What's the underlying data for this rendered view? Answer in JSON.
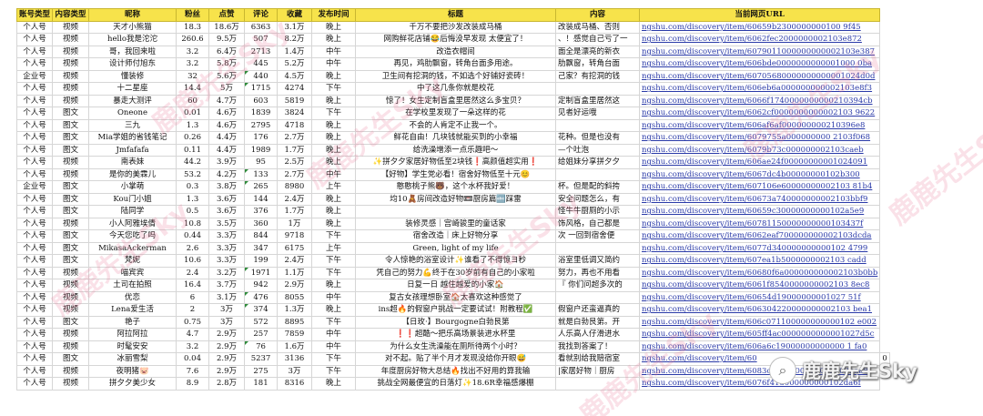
{
  "headers": [
    "账号类型",
    "内容类型",
    "昵称",
    "粉丝",
    "点赞",
    "评论",
    "收藏",
    "发布时间",
    "标题",
    "内容",
    "当前网页URL"
  ],
  "rows": [
    [
      "个人号",
      "视频",
      "天才小熊猫",
      "18.3",
      "18.6万",
      "6363",
      "3.1万",
      "晚上",
      "千万不要把沙发改装成马桶",
      "改装成马桶、否则",
      "ngshu.com/discovery/item/60659b2300000000100 9f45"
    ],
    [
      "个人号",
      "视频",
      "hello我是沱沱",
      "260.6",
      "9.5万",
      "507",
      "8.2万",
      "晚上",
      "网购鲜花店铺😂后悔没早发现 太便宜了！",
      "、！感觉自己亏了一",
      "ngshu.com/discovery/item/6062fec2000000002103e872"
    ],
    [
      "个人号",
      "视频",
      "哥，我回来啦",
      "3.2",
      "6.4万",
      "2713",
      "1.4万",
      "中午",
      "改造衣帽间",
      "面全是漂亮的新衣",
      "ngshu.com/discovery/item/6079011000000000002103e387"
    ],
    [
      "个人号",
      "视频",
      "设计师付旭东",
      "3.2",
      "5.8万",
      "445",
      "5.2万",
      "中午",
      "再见，鸡肋飘窗，转角台面多用途。",
      "肋飘窗，转角台面",
      "ngshu.com/discovery/item/606bde0000000000001000 0ba"
    ],
    [
      "企业号",
      "视频",
      "懂装修",
      "32",
      "5.6万",
      "440",
      "4.5万",
      "晚上",
      "卫生间有挖洞的钱，不如选个好铺好瓷砖！",
      "己家？有挖洞的钱",
      "ngshu.com/discovery/item/60705680000000000001024d0d"
    ],
    [
      "个人号",
      "视频",
      "十二星座",
      "14.4",
      "5万",
      "1715",
      "4274",
      "下午",
      "中了这几条你就是校花",
      "",
      "ngshu.com/discovery/item/606eb6a000000000002103e8f3"
    ],
    [
      "个人号",
      "视频",
      "暴走大测评",
      "60",
      "4.7万",
      "603",
      "5819",
      "晚上",
      "惊了！女生定制盲盒里居然这么多宝贝？",
      "定制盲盒里居然这",
      "ngshu.com/discovery/item/6066f1740000000000210394cb"
    ],
    [
      "个人号",
      "图文",
      "Oneone",
      "0.01",
      "4.6万",
      "1839",
      "3824",
      "下午",
      "在学校里发现了一朵这样的花",
      "见者好运哦",
      "ngshu.com/discovery/item/6062cf0000000000002103 9622"
    ],
    [
      "个人号",
      "图文",
      "三九",
      "1.3",
      "4.6万",
      "2795",
      "4718",
      "晚上",
      "不会的人肯定不止我一个。",
      "",
      "ngshu.com/discovery/item/606af6af000000000210396e8"
    ],
    [
      "个人号",
      "图文",
      "Mia学姐的省钱笔记",
      "0.26",
      "4.4万",
      "176",
      "2.7万",
      "晚上",
      "鲜花自由！几块钱就能买到的小幸福",
      "花种。但是也没有",
      "ngshu.com/discovery/item/6079755a000000000 2103f068"
    ],
    [
      "个人号",
      "图文",
      "Jmfafafa",
      "0.11",
      "4.4万",
      "1989",
      "1.7万",
      "晚上",
      "给洗澡增添一点乐趣吧～",
      "—个吐泡",
      "ngshu.com/discovery/item/6079b73c000000002103caeb"
    ],
    [
      "个人号",
      "视频",
      "南表妹",
      "44.2",
      "3.9万",
      "95",
      "2.5万",
      "晚上",
      "✨拼夕夕家居好物低至2块钱❗高颜值超实用❗",
      "给姐妹分享拼夕夕",
      "ngshu.com/discovery/item/606ae24f00000000001024091"
    ],
    [
      "个人号",
      "视频",
      "是你的美霖儿",
      "53.2",
      "4.2万",
      "133",
      "2.7万",
      "中午",
      "【好物】学生党必看！宿舍好物低至十元😊",
      "",
      "ngshu.com/discovery/item/6067dc4b00000000102b300"
    ],
    [
      "企业号",
      "图文",
      "小掌萌",
      "0.3",
      "3.8万",
      "265",
      "8980",
      "上午",
      "憨憨桃子熊🐻，这个水杯我好爱！",
      "杯。但是配的斜挎",
      "ngshu.com/discovery/item/607106e60000000002103 81b4"
    ],
    [
      "个人号",
      "图文",
      "Kou门小姐",
      "1.3",
      "3.6万",
      "144",
      "2.4万",
      "晚上",
      "均10🧸房间改造好物📼厨房篇🔤踩雷",
      "安全问题怎么，有",
      "ngshu.com/discovery/item/60673a740000000002103bbf9"
    ],
    [
      "个人号",
      "图文",
      "陆同学",
      "0.5",
      "3.6万",
      "376",
      "1.7万",
      "晚上",
      "",
      "怪牛牛厨厕的小示",
      "ngshu.com/discovery/item/60659c30000000000102a5e9"
    ],
    [
      "个人号",
      "视频",
      "小人阿雅埃倩",
      "10.8",
      "3.5万",
      "360",
      "1万",
      "晚上",
      "装修灵感｜宫崎骏里的童话家",
      "饰风格，自己都是",
      "ngshu.com/discovery/item/60781150000000000103437f"
    ],
    [
      "个人号",
      "图文",
      "今天您吃了吗",
      "0.44",
      "3.3万",
      "844",
      "9718",
      "下午",
      "宿舍改造｜床上好物分享",
      "次 一回到宿舍便",
      "ngshu.com/discovery/item/6062eaf700000000002103dcda"
    ],
    [
      "个人号",
      "图文",
      "MikasaAckerman",
      "2.6",
      "3.3万",
      "347",
      "6175",
      "上午",
      "Green, light of my life",
      "",
      "ngshu.com/discovery/item/6077d340000000000102 4799"
    ],
    [
      "个人号",
      "图文",
      "梵妮",
      "10.6",
      "3.3万",
      "199",
      "2.4万",
      "下午",
      "令人惊艳的浴室设计✨谁看了不得惊ヨ秒",
      "浴室里低调又简约",
      "ngshu.com/discovery/item/607ea1b5000000002103 cadd"
    ],
    [
      "个人号",
      "视频",
      "喵宾宾",
      "2.4",
      "3.2万",
      "1971",
      "1.1万",
      "下午",
      "凭自己的努力💪终于在30岁前有自己的小家啦",
      "努力，再也不用看",
      "ngshu.com/discovery/item/60680f6a000000000002103b0bb"
    ],
    [
      "个人号",
      "视频",
      "土司在拍照",
      "16.4",
      "3.7万",
      "942",
      "2.9万",
      "晚上",
      "日复一日 越住越爱的小家🏠",
      "『 你们问超多次的",
      "ngshu.com/discovery/item/6061f8540000000002103 8ec8"
    ],
    [
      "个人号",
      "视频",
      "优恋",
      "6",
      "3.1万",
      "476",
      "8055",
      "中午",
      "复古女孩理想卧室🏠太喜欢这种感觉了",
      "",
      "ngshu.com/discovery/item/60654d19000000001027 51f"
    ],
    [
      "个人号",
      "视频",
      "Lena爱生活",
      "2",
      "3万",
      "374",
      "1.3万",
      "晚上",
      "ins超🔥的假窗户挑战一定要试试！附教程✅",
      "假窗户还蛮逼真的",
      "ngshu.com/discovery/item/606304220000000002103 bea1"
    ],
    [
      "个人号",
      "图文",
      "艳子",
      "0.75",
      "3万",
      "572",
      "8895",
      "下午",
      "【日玫·】Bourgogne白勃艮第",
      "就是白勃艮第。开",
      "ngshu.com/discovery/item/606c071100000000000102 e002"
    ],
    [
      "个人号",
      "视频",
      "阿拉阿拉",
      "4.7",
      "2.9万",
      "257",
      "7859",
      "中午",
      "❗❗超酷～把乐高场景装进水杯里",
      "人乐高人仔滑进水",
      "ngshu.com/discovery/item/605ff4ac0000000000001027d5c"
    ],
    [
      "个人号",
      "视频",
      "时髦安安",
      "3.2",
      "2.9万",
      "76",
      "1.6万",
      "中午",
      "为什么女生洗澡能在厕所待两个小时？",
      "我找到答案了！",
      "ngshu.com/discovery/item/606a6c19000000000000 1 fa0"
    ],
    [
      "个人号",
      "图文",
      "冰丽雪梨",
      "0.04",
      "2.9万",
      "5237",
      "3136",
      "下午",
      "对不起。贴了半个月才发现没给你开眼😅",
      "看就别给我赔宿室",
      "ngshu.com/discovery/item/60",
      "0"
    ],
    [
      "个人号",
      "视频",
      "夜明猪🐷",
      "7.6",
      "2.9万",
      "275",
      "3万",
      "下午",
      "年度厨房好物大总结🔥找出不好用的算我输",
      "|家居好物｜厨房",
      "ngshu.com/discovery/item/6083ce4e0000000002103baa8"
    ],
    [
      "个人号",
      "视频",
      "拼夕夕美少女",
      "8.9",
      "2.8万",
      "181",
      "8316",
      "晚上",
      "挑战全网最便宜的日落灯✨18.6R幸福感爆棚",
      "",
      "ngshu.com/discovery/item/6076f418000000000102da6f"
    ]
  ],
  "watermarks": [
    "鹿鹿先生Sky",
    "鹿鹿先生Sky",
    "鹿鹿先生Sky",
    "鹿鹿先生Sky",
    "鹿鹿先生Sky",
    "鹿鹿先生Sky",
    "鹿鹿先生Sky"
  ],
  "brand": {
    "logo_icon": "wechat-icon",
    "text": "鹿鹿先生Sky"
  }
}
